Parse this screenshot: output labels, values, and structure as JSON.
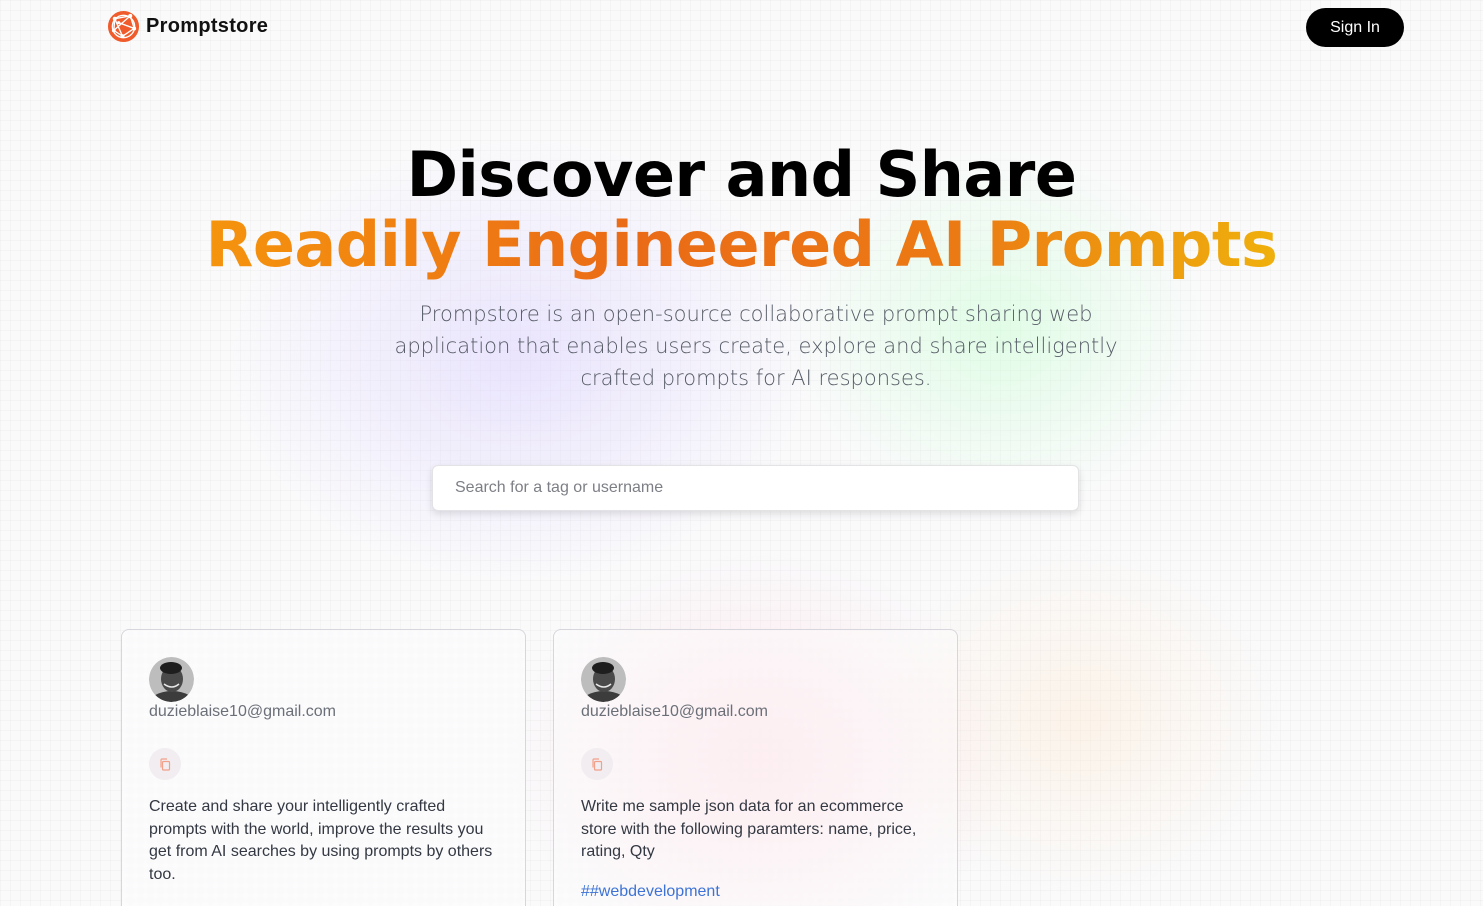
{
  "brand": {
    "name": "Promptstore",
    "logo_icon": "globe-network-icon",
    "logo_color": "#ef5b2a"
  },
  "nav": {
    "signin_label": "Sign In"
  },
  "hero": {
    "title_line1": "Discover and Share",
    "title_line2": "Readily Engineered AI Prompts",
    "description": "Prompstore is an open-source collaborative prompt sharing web application that enables users create, explore and share intelligently crafted prompts for AI responses."
  },
  "search": {
    "placeholder": "Search for a tag or username",
    "value": ""
  },
  "colors": {
    "accent_gradient": [
      "#f5940d",
      "#ea6b17",
      "#efb00c"
    ],
    "tag_link": "#3d73d6",
    "copy_icon": "#f2a08a"
  },
  "prompts": [
    {
      "email": "duzieblaise10@gmail.com",
      "copy_icon": "copy-icon",
      "text": "Create and share your intelligently crafted prompts with the world, improve the results you get from AI searches by using prompts by others too.",
      "tag": ""
    },
    {
      "email": "duzieblaise10@gmail.com",
      "copy_icon": "copy-icon",
      "text": "Write me sample json data for an ecommerce store with the following paramters: name, price, rating, Qty",
      "tag": "##webdevelopment"
    }
  ]
}
